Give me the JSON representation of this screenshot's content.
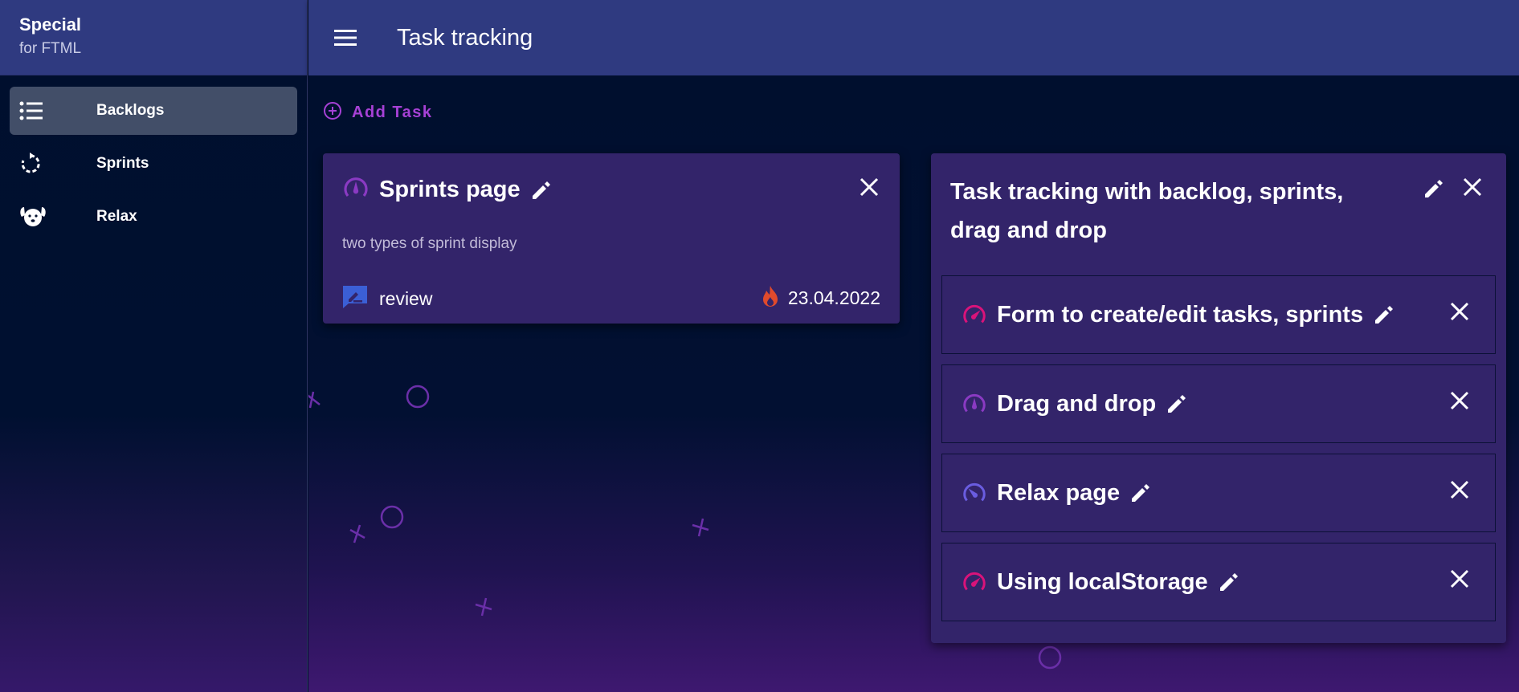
{
  "brand": {
    "title": "Special",
    "subtitle": "for FTML"
  },
  "sidebar": {
    "items": [
      {
        "label": "Backlogs",
        "icon": "list-icon",
        "active": true
      },
      {
        "label": "Sprints",
        "icon": "refresh-icon",
        "active": false
      },
      {
        "label": "Relax",
        "icon": "dog-icon",
        "active": false
      }
    ]
  },
  "header": {
    "title": "Task tracking"
  },
  "toolbar": {
    "add_task_label": "Add Task"
  },
  "cards": [
    {
      "title": "Sprints page",
      "priority_icon": "speedometer-low-icon",
      "description": "two types of sprint display",
      "status": "review",
      "status_icon": "review-icon",
      "date": "23.04.2022",
      "date_icon": "fire-icon"
    },
    {
      "title": "Task tracking with backlog, sprints, drag and drop",
      "subtasks": [
        {
          "title": "Form to create/edit tasks, sprints",
          "priority_icon": "speedometer-high-icon",
          "priority_color": "#d9137a"
        },
        {
          "title": "Drag and drop",
          "priority_icon": "speedometer-low-icon",
          "priority_color": "#8a3ac2"
        },
        {
          "title": "Relax page",
          "priority_icon": "speedometer-medium-icon",
          "priority_color": "#6a5de0"
        },
        {
          "title": "Using localStorage",
          "priority_icon": "speedometer-high-icon",
          "priority_color": "#d9137a"
        }
      ]
    }
  ],
  "colors": {
    "accent": "#a641d6",
    "topbar": "#2f3a80",
    "card": "#33246a",
    "active_nav": "#424e68",
    "fire": "#e04a2c",
    "review": "#3b5fd6"
  }
}
